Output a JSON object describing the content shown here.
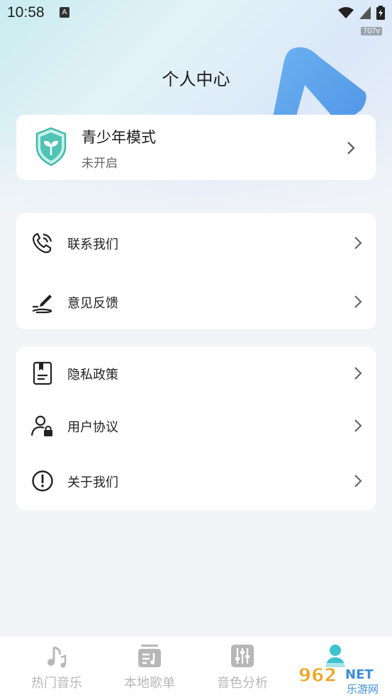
{
  "status_bar": {
    "time": "10:58",
    "notification_badge": "A",
    "net_speed": "707v"
  },
  "header": {
    "title": "个人中心"
  },
  "youth_mode": {
    "title": "青少年模式",
    "status": "未开启",
    "icon": "shield-sprout-icon",
    "accent": "#4fc3b4"
  },
  "group1": [
    {
      "label": "联系我们",
      "icon": "phone-icon"
    },
    {
      "label": "意见反馈",
      "icon": "pen-icon"
    }
  ],
  "group2": [
    {
      "label": "隐私政策",
      "icon": "document-icon"
    },
    {
      "label": "用户协议",
      "icon": "user-lock-icon"
    },
    {
      "label": "关于我们",
      "icon": "info-alert-icon"
    }
  ],
  "tabs": [
    {
      "label": "热门音乐",
      "icon": "music-note-icon",
      "active": false
    },
    {
      "label": "本地歌单",
      "icon": "playlist-icon",
      "active": false
    },
    {
      "label": "音色分析",
      "icon": "equalizer-icon",
      "active": false
    },
    {
      "label": "",
      "icon": "person-icon",
      "active": true
    }
  ],
  "watermark": {
    "text_top": "962",
    "text_net": "NET",
    "text_bottom": "乐游网"
  }
}
